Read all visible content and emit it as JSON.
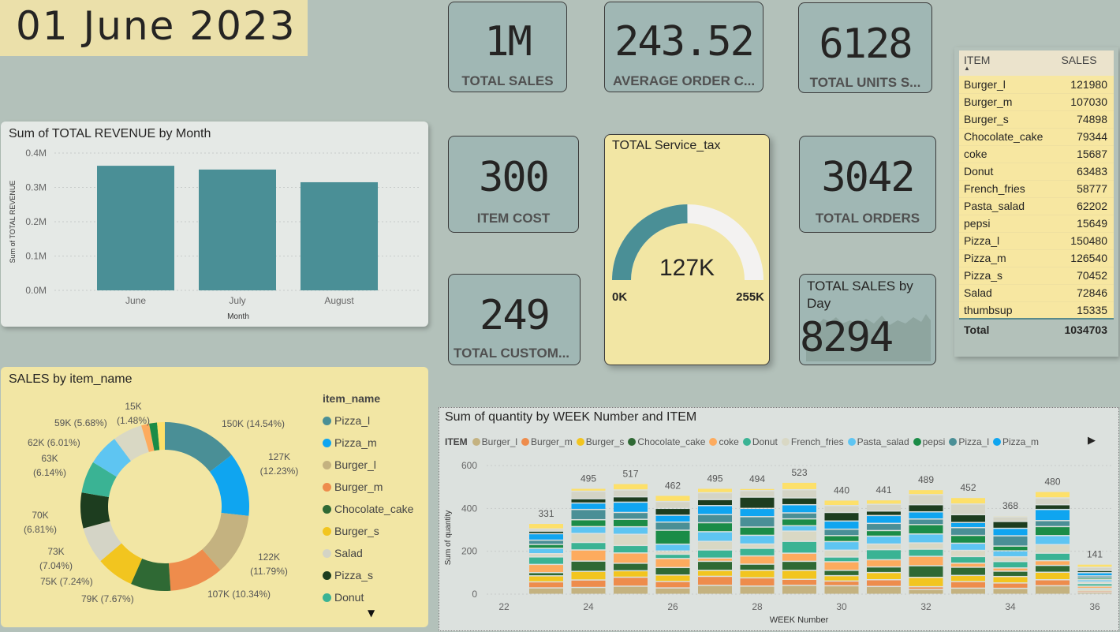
{
  "header": {
    "date": "01 June 2023"
  },
  "kpis": {
    "total_sales": {
      "value": "1M",
      "label": "TOTAL SALES"
    },
    "avg_order": {
      "value": "243.52",
      "label": "AVERAGE ORDER C..."
    },
    "total_units": {
      "value": "6128",
      "label": "TOTAL UNITS S..."
    },
    "item_cost": {
      "value": "300",
      "label": "ITEM COST"
    },
    "total_orders": {
      "value": "3042",
      "label": "TOTAL ORDERS"
    },
    "total_customers": {
      "value": "249",
      "label": "TOTAL CUSTOM..."
    },
    "sales_by_day": {
      "title": "TOTAL SALES by Day",
      "value": "8294"
    }
  },
  "gauge": {
    "title": "TOTAL Service_tax",
    "value": 127000,
    "value_label": "127K",
    "min": 0,
    "min_label": "0K",
    "max": 255000,
    "max_label": "255K",
    "fill_color": "#4a8f96",
    "track_color": "#f3f2f1"
  },
  "table": {
    "headers": [
      "ITEM",
      "SALES"
    ],
    "sort_icon": "sort-ascending-icon",
    "rows": [
      [
        "Burger_l",
        "121980"
      ],
      [
        "Burger_m",
        "107030"
      ],
      [
        "Burger_s",
        "74898"
      ],
      [
        "Chocolate_cake",
        "79344"
      ],
      [
        "coke",
        "15687"
      ],
      [
        "Donut",
        "63483"
      ],
      [
        "French_fries",
        "58777"
      ],
      [
        "Pasta_salad",
        "62202"
      ],
      [
        "pepsi",
        "15649"
      ],
      [
        "Pizza_l",
        "150480"
      ],
      [
        "Pizza_m",
        "126540"
      ],
      [
        "Pizza_s",
        "70452"
      ],
      [
        "Salad",
        "72846"
      ],
      [
        "thumbsup",
        "15335"
      ]
    ],
    "total_label": "Total",
    "total_value": "1034703"
  },
  "colors": {
    "Burger_l": "#c4b280",
    "Burger_m": "#ee8c4c",
    "Burger_s": "#f2c51f",
    "Chocolate_cake": "#2f6934",
    "coke": "#fdab5e",
    "Donut": "#3ab394",
    "French_fries": "#d9d8c4",
    "Pasta_salad": "#5ec5f2",
    "pepsi": "#1b8c47",
    "Pizza_l": "#4a8f96",
    "Pizza_m": "#0fa5f0",
    "Pizza_s": "#1d3d1f",
    "Salad": "#d4d4c6",
    "thumbsup": "#fde06a"
  },
  "chart_data": [
    {
      "type": "bar",
      "title": "Sum of TOTAL REVENUE by Month",
      "xlabel": "Month",
      "ylabel": "Sum of TOTAL REVENUE",
      "categories": [
        "June",
        "July",
        "August"
      ],
      "values": [
        363000,
        352000,
        315000
      ],
      "ylim": [
        0,
        400000
      ],
      "yticks": [
        "0.0M",
        "0.1M",
        "0.2M",
        "0.3M",
        "0.4M"
      ],
      "ytick_values": [
        0,
        100000,
        200000,
        300000,
        400000
      ],
      "color": "#4a8f96",
      "grid": true
    },
    {
      "type": "pie",
      "title": "SALES by item_name",
      "legend_title": "item_name",
      "legend_position": "right",
      "legend_items": [
        "Pizza_l",
        "Pizza_m",
        "Burger_l",
        "Burger_m",
        "Chocolate_cake",
        "Burger_s",
        "Salad",
        "Pizza_s",
        "Donut"
      ],
      "slices": [
        {
          "name": "Pizza_l",
          "value": 150480,
          "label": "150K (14.54%)"
        },
        {
          "name": "Pizza_m",
          "value": 126540,
          "label": "127K (12.23%)"
        },
        {
          "name": "Burger_l",
          "value": 121980,
          "label": "122K (11.79%)"
        },
        {
          "name": "Burger_m",
          "value": 107030,
          "label": "107K (10.34%)"
        },
        {
          "name": "Chocolate_cake",
          "value": 79344,
          "label": "79K (7.67%)"
        },
        {
          "name": "Burger_s",
          "value": 74898,
          "label": "75K (7.24%)"
        },
        {
          "name": "Salad",
          "value": 72846,
          "label": "73K (7.04%)"
        },
        {
          "name": "Pizza_s",
          "value": 70452,
          "label": "70K (6.81%)"
        },
        {
          "name": "Donut",
          "value": 63483,
          "label": "63K (6.14%)"
        },
        {
          "name": "Pasta_salad",
          "value": 62202,
          "label": "62K (6.01%)"
        },
        {
          "name": "French_fries",
          "value": 58777,
          "label": "59K (5.68%)"
        },
        {
          "name": "coke",
          "value": 15687,
          "label": "15K (1.48%)"
        },
        {
          "name": "pepsi",
          "value": 15649,
          "label": ""
        },
        {
          "name": "thumbsup",
          "value": 15335,
          "label": ""
        }
      ]
    },
    {
      "type": "bar",
      "stacked": true,
      "title": "Sum of quantity by WEEK Number and ITEM",
      "xlabel": "WEEK Number",
      "ylabel": "Sum of quantity",
      "legend_title": "ITEM",
      "legend_position": "top",
      "legend_items": [
        "Burger_l",
        "Burger_m",
        "Burger_s",
        "Chocolate_cake",
        "coke",
        "Donut",
        "French_fries",
        "Pasta_salad",
        "pepsi",
        "Pizza_l",
        "Pizza_m"
      ],
      "x": [
        23,
        24,
        25,
        26,
        27,
        28,
        29,
        30,
        31,
        32,
        33,
        34,
        35,
        36
      ],
      "xticks": [
        22,
        24,
        26,
        28,
        30,
        32,
        34,
        36
      ],
      "ylim": [
        0,
        600
      ],
      "yticks": [
        0,
        200,
        400,
        600
      ],
      "totals": [
        331,
        495,
        517,
        462,
        495,
        494,
        523,
        440,
        441,
        489,
        452,
        368,
        480,
        141
      ],
      "series": [
        {
          "name": "Burger_l",
          "values": [
            30,
            32,
            38,
            30,
            42,
            38,
            42,
            40,
            35,
            22,
            30,
            28,
            40,
            8
          ]
        },
        {
          "name": "Burger_m",
          "values": [
            28,
            35,
            42,
            30,
            42,
            38,
            28,
            22,
            30,
            12,
            32,
            25,
            28,
            8
          ]
        },
        {
          "name": "Burger_s",
          "values": [
            28,
            40,
            30,
            30,
            28,
            35,
            42,
            25,
            32,
            42,
            30,
            30,
            35,
            6
          ]
        },
        {
          "name": "Chocolate_cake",
          "values": [
            15,
            48,
            35,
            35,
            42,
            28,
            42,
            25,
            25,
            52,
            40,
            25,
            32,
            6
          ]
        },
        {
          "name": "coke",
          "values": [
            38,
            52,
            48,
            42,
            15,
            38,
            38,
            40,
            32,
            42,
            20,
            15,
            22,
            10
          ]
        },
        {
          "name": "Donut",
          "values": [
            35,
            35,
            35,
            20,
            38,
            35,
            55,
            22,
            45,
            32,
            32,
            30,
            35,
            12
          ]
        },
        {
          "name": "French_fries",
          "values": [
            15,
            42,
            52,
            15,
            40,
            20,
            48,
            32,
            25,
            28,
            30,
            22,
            40,
            8
          ]
        },
        {
          "name": "Pasta_salad",
          "values": [
            25,
            32,
            35,
            32,
            45,
            40,
            25,
            40,
            35,
            40,
            35,
            28,
            42,
            10
          ]
        },
        {
          "name": "pepsi",
          "values": [
            18,
            32,
            35,
            65,
            42,
            38,
            32,
            28,
            25,
            42,
            38,
            22,
            42,
            8
          ]
        },
        {
          "name": "Pizza_l",
          "values": [
            20,
            48,
            32,
            38,
            38,
            48,
            28,
            30,
            32,
            25,
            38,
            48,
            28,
            10
          ]
        },
        {
          "name": "Pizza_m",
          "values": [
            30,
            30,
            48,
            32,
            42,
            38,
            38,
            38,
            35,
            32,
            25,
            35,
            52,
            15
          ]
        },
        {
          "name": "Pizza_s",
          "values": [
            12,
            20,
            25,
            32,
            28,
            52,
            32,
            40,
            20,
            32,
            38,
            32,
            22,
            10
          ]
        },
        {
          "name": "Salad",
          "values": [
            10,
            35,
            32,
            32,
            32,
            30,
            38,
            32,
            30,
            45,
            52,
            22,
            32,
            15
          ]
        },
        {
          "name": "thumbsup",
          "values": [
            26,
            14,
            30,
            29,
            21,
            10,
            35,
            26,
            20,
            23,
            32,
            6,
            30,
            15
          ]
        }
      ]
    }
  ]
}
